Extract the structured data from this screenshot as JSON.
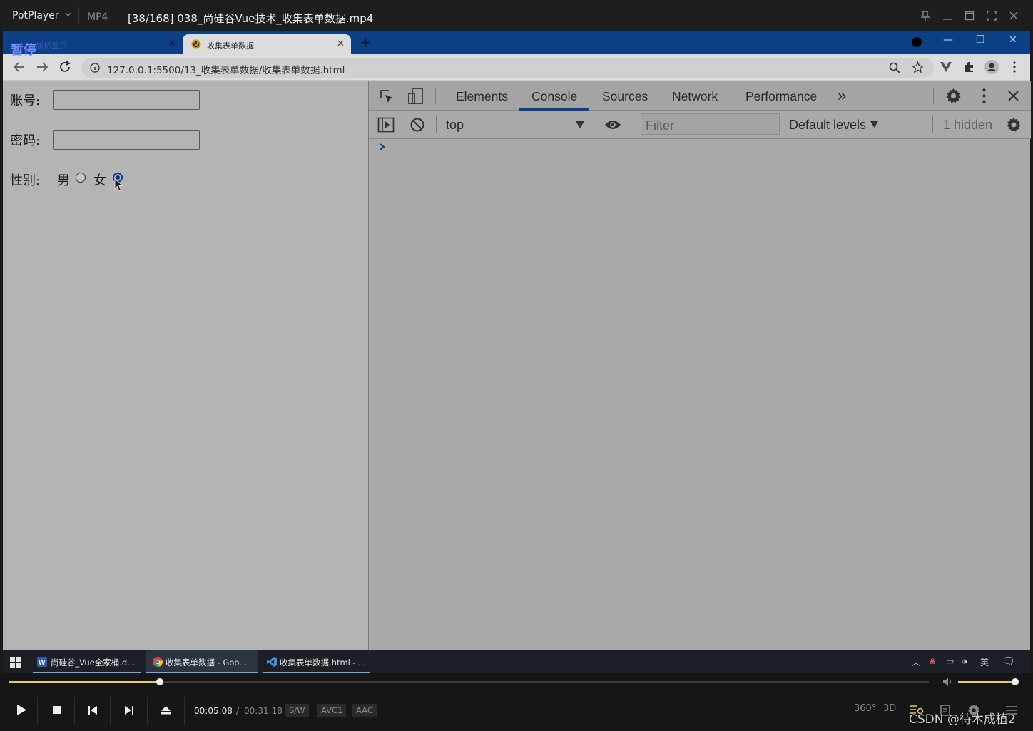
{
  "player": {
    "app_name": "PotPlayer",
    "format": "MP4",
    "file_title": "[38/168] 038_尚硅谷Vue技术_收集表单数据.mp4",
    "pause_overlay": "暂停"
  },
  "browser": {
    "tabs": [
      {
        "title": "新标签页"
      },
      {
        "title": "收集表单数据"
      }
    ],
    "url": "127.0.0.1:5500/13_收集表单数据/收集表单数据.html"
  },
  "page": {
    "account_label": "账号:",
    "password_label": "密码:",
    "gender_label": "性别:",
    "male_label": "男",
    "female_label": "女",
    "account_value": "",
    "password_value": "",
    "gender_selected": "女"
  },
  "devtools": {
    "tabs": [
      "Elements",
      "Console",
      "Sources",
      "Network",
      "Performance"
    ],
    "active_tab": "Console",
    "more_tabs_glyph": "»",
    "context": "top",
    "filter_placeholder": "Filter",
    "levels": "Default levels",
    "hidden_count": "1 hidden",
    "prompt_glyph": "›"
  },
  "taskbar": {
    "items": [
      {
        "title": "尚硅谷_Vue全家桶.d..."
      },
      {
        "title": "收集表单数据 - Goo..."
      },
      {
        "title": "收集表单数据.html - ..."
      }
    ],
    "ime": "英"
  },
  "playback": {
    "current_time": "00:05:08",
    "separator": "/",
    "total_time": "00:31:18",
    "progress": 0.164,
    "volume": 0.97,
    "badges": [
      "S/W",
      "AVC1",
      "AAC"
    ],
    "right_labels": [
      "360°",
      "3D"
    ]
  },
  "watermark": "CSDN @待木成植2",
  "colors": {
    "accent": "#e8c96b",
    "tabstrip": "#0b3f86",
    "devtools_active": "#0c3f8e"
  }
}
